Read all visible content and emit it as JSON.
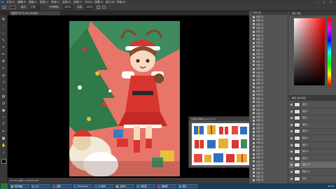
{
  "app": {
    "logo": "Ps"
  },
  "menubar": {
    "items": [
      "文件(F)",
      "编辑(E)",
      "图像(I)",
      "图层(L)",
      "类型(Y)",
      "选择(S)",
      "滤镜(T)",
      "3D(D)",
      "视图(V)",
      "窗口(W)",
      "帮助(H)"
    ],
    "window_controls": [
      "—",
      "□",
      "✕"
    ]
  },
  "options": {
    "mode_label": "模式:",
    "mode_value": "正常",
    "opacity_label": "不透明度:",
    "opacity_value": "100%",
    "flow_label": "流量:",
    "flow_value": "100%"
  },
  "document": {
    "tab_title": "圣诞节 @ 33.3% (RGB/8)"
  },
  "tools": [
    "move-icon",
    "marquee-icon",
    "lasso-icon",
    "quick-select-icon",
    "crop-icon",
    "eyedropper-icon",
    "healing-icon",
    "brush-icon",
    "stamp-icon",
    "history-brush-icon",
    "eraser-icon",
    "gradient-icon",
    "blur-icon",
    "dodge-icon",
    "pen-icon",
    "type-icon",
    "path-select-icon",
    "shape-icon",
    "hand-icon",
    "zoom-icon"
  ],
  "floating": {
    "title": "圣诞礼物素材.jpg @ 50%"
  },
  "history": {
    "header": "历史记录",
    "items": [
      "画笔工具",
      "画笔工具",
      "画笔工具",
      "画笔工具",
      "画笔工具",
      "画笔工具",
      "画笔工具",
      "画笔工具",
      "画笔工具",
      "画笔工具",
      "画笔工具",
      "画笔工具",
      "画笔工具",
      "画笔工具",
      "画笔工具",
      "画笔工具",
      "画笔工具",
      "画笔工具",
      "画笔工具",
      "画笔工具",
      "画笔工具",
      "画笔工具",
      "画笔工具",
      "画笔工具",
      "画笔工具",
      "画笔工具",
      "画笔工具",
      "画笔工具",
      "画笔工具",
      "画笔工具",
      "画笔工具",
      "画笔工具",
      "画笔工具",
      "画笔工具",
      "画笔工具",
      "画笔工具",
      "画笔工具",
      "画笔工具",
      "画笔工具",
      "画笔工具",
      "画笔工具",
      "画笔工具",
      "画笔工具",
      "画笔工具",
      "画笔工具"
    ]
  },
  "color": {
    "header": "颜色  色板"
  },
  "layers": {
    "header": "图层  通道  路径",
    "rows": [
      {
        "name": "图层 1",
        "selected": false
      },
      {
        "name": "图层 2",
        "selected": false
      },
      {
        "name": "图层 3",
        "selected": false
      },
      {
        "name": "图层 4",
        "selected": false
      },
      {
        "name": "图层 5",
        "selected": false
      },
      {
        "name": "图层 6",
        "selected": false
      },
      {
        "name": "图层 7",
        "selected": false
      },
      {
        "name": "图层 8",
        "selected": false
      },
      {
        "name": "图层 9",
        "selected": false
      },
      {
        "name": "图层 10",
        "selected": true
      },
      {
        "name": "图层 11",
        "selected": false
      },
      {
        "name": "背景",
        "selected": false
      }
    ]
  },
  "status": {
    "text": "33.33%   文档:7.91M/231.4M"
  },
  "taskbar": {
    "items": [
      {
        "label": "我的电脑",
        "color": "#e0b030"
      },
      {
        "label": "QQ",
        "color": "#3aa0e0"
      },
      {
        "label": "画图",
        "color": "#c04040"
      },
      {
        "label": "Photoshop",
        "color": "#2f6fd0"
      },
      {
        "label": "Ps 素材",
        "color": "#2f6fd0"
      },
      {
        "label": "文件夹",
        "color": "#e0b030"
      },
      {
        "label": "浏览器",
        "color": "#40a040"
      },
      {
        "label": "播放器",
        "color": "#d04040"
      },
      {
        "label": "图片",
        "color": "#3aa0e0"
      }
    ],
    "clock": "20:15"
  }
}
